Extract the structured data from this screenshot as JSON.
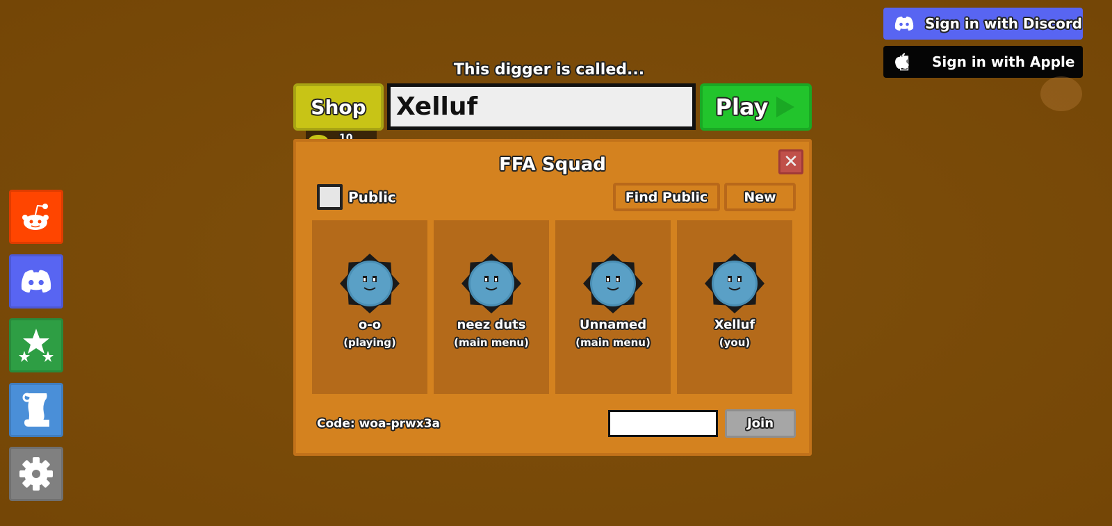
{
  "auth": {
    "discord_label": "Sign in with Discord",
    "apple_label": "Sign in with Apple"
  },
  "header": {
    "caption": "This digger is called...",
    "shop_label": "Shop",
    "name_value": "Xelluf",
    "play_label": "Play",
    "coins": "10"
  },
  "sidebar": {
    "items": [
      {
        "icon": "reddit-icon",
        "color": "#ff4500"
      },
      {
        "icon": "discord-icon",
        "color": "#5865f2"
      },
      {
        "icon": "stars-icon",
        "color": "#2e9e44"
      },
      {
        "icon": "scroll-icon",
        "color": "#4a8fd8"
      },
      {
        "icon": "gear-icon",
        "color": "#808080"
      }
    ]
  },
  "squad": {
    "title": "FFA Squad",
    "public_label": "Public",
    "public_checked": false,
    "find_public_label": "Find Public",
    "new_label": "New",
    "members": [
      {
        "name": "o-o",
        "status": "(playing)"
      },
      {
        "name": "neez duts",
        "status": "(main menu)"
      },
      {
        "name": "Unnamed",
        "status": "(main menu)"
      },
      {
        "name": "Xelluf",
        "status": "(you)"
      }
    ],
    "code_label": "Code: woa-prwx3a",
    "join_input_value": "",
    "join_label": "Join"
  },
  "colors": {
    "background": "#7a4a08",
    "panel": "#d4821f",
    "card": "#b46a1a",
    "play": "#22c42c",
    "shop": "#c8c416",
    "discord": "#5865f2"
  }
}
